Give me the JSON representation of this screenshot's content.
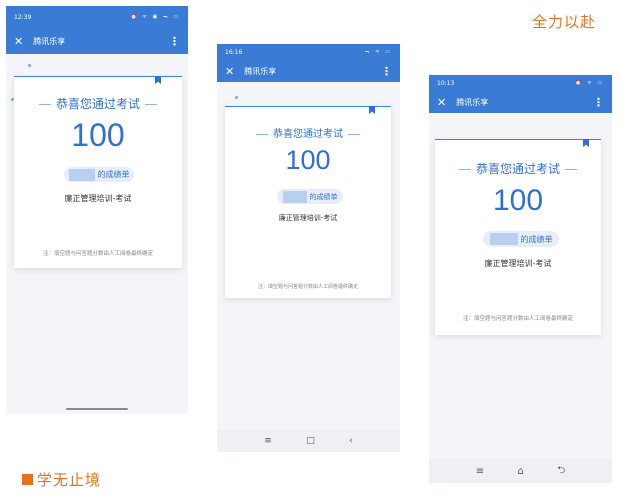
{
  "slogans": {
    "top": "全力以赴",
    "bottom": "学无止境"
  },
  "phones": [
    {
      "time": "12:39",
      "status_icons": "⏰ ᯤ ▣ ᯓ ▭",
      "app_title": "腾讯乐享",
      "headline": "恭喜您通过考试",
      "score": "100",
      "report_suffix": "的成绩单",
      "exam_name": "廉正管理培训-考试",
      "note": "注：填空题与问答题分数由人工阅卷最终确定"
    },
    {
      "time": "16:16",
      "status_icons": "ᯓ ᯤ ▭",
      "app_title": "腾讯乐享",
      "headline": "恭喜您通过考试",
      "score": "100",
      "report_suffix": "的成绩单",
      "exam_name": "廉正管理培训-考试",
      "note": "注：填空题与问答题分数由人工阅卷最终确定",
      "nav": {
        "menu": "≡",
        "home": "□",
        "back": "‹"
      }
    },
    {
      "time": "10:13",
      "status_icons": "⏰ ᯤ ▭",
      "app_title": "腾讯乐享",
      "headline": "恭喜您通过考试",
      "score": "100",
      "report_suffix": "的成绩单",
      "exam_name": "廉正管理培训-考试",
      "note": "注：填空题与问答题分数由人工阅卷最终确定",
      "nav": {
        "menu": "≡",
        "home": "⌂",
        "back": "⮌"
      }
    }
  ],
  "icons": {
    "close": "close-icon",
    "more": "more-vertical-icon",
    "bookmark": "bookmark-flag-icon"
  },
  "colors": {
    "brand_blue": "#3a7bd5",
    "accent_orange": "#e8711c",
    "score_blue": "#2f6fd6"
  }
}
